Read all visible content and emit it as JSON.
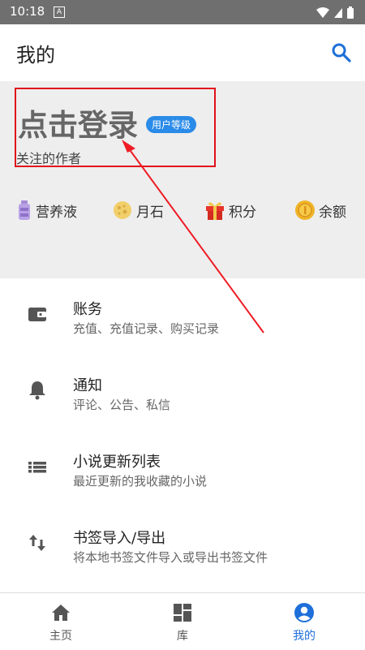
{
  "status": {
    "time": "10:18",
    "notif_glyph": "A"
  },
  "appbar": {
    "title": "我的",
    "search_icon": "search-icon"
  },
  "profile": {
    "login_text": "点击登录",
    "level_badge": "用户等级",
    "follow_text": "关注的作者"
  },
  "stats": [
    {
      "label": "营养液",
      "icon": "bottle-icon"
    },
    {
      "label": "月石",
      "icon": "moonstone-icon"
    },
    {
      "label": "积分",
      "icon": "gift-icon"
    },
    {
      "label": "余额",
      "icon": "coin-icon"
    }
  ],
  "menu": [
    {
      "title": "账务",
      "subtitle": "充值、充值记录、购买记录",
      "icon": "wallet-icon"
    },
    {
      "title": "通知",
      "subtitle": "评论、公告、私信",
      "icon": "bell-icon"
    },
    {
      "title": "小说更新列表",
      "subtitle": "最近更新的我收藏的小说",
      "icon": "list-icon"
    },
    {
      "title": "书签导入/导出",
      "subtitle": "将本地书签文件导入或导出书签文件",
      "icon": "import-export-icon"
    }
  ],
  "nav": [
    {
      "label": "主页",
      "icon": "home-icon"
    },
    {
      "label": "库",
      "icon": "library-icon"
    },
    {
      "label": "我的",
      "icon": "account-icon"
    }
  ],
  "colors": {
    "accent": "#1e6fd9",
    "highlight": "#e0101b",
    "header_bg": "#eeeeee"
  }
}
